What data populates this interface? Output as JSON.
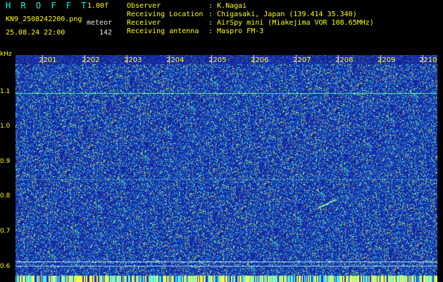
{
  "header": {
    "title": "H R O F F T",
    "version": "1.00f",
    "filename": "KN9_2508242200.png",
    "datetime": "25.08.24 22:00",
    "category": "meteor",
    "count": "142",
    "info": [
      {
        "label": "Observer",
        "value": ": K.Nagai"
      },
      {
        "label": "Receiving Location",
        "value": ": Chigasaki, Japan (139.414 35.340)"
      },
      {
        "label": "Receiver",
        "value": ": AirSpy mini (Miakejima VOR 108.65MHz)"
      },
      {
        "label": "Receiving antenna",
        "value": ": Maspro FM-3"
      }
    ]
  },
  "axis": {
    "y_unit": "kHz",
    "y_ticks": [
      "1.1",
      "1.0",
      "0.9",
      "0.8",
      "0.7",
      "0.6"
    ],
    "x_ticks": [
      "2201",
      "2202",
      "2203",
      "2204",
      "2205",
      "2206",
      "2207",
      "2208",
      "2209",
      "2210"
    ]
  },
  "colors": {
    "background": "#000000",
    "spectrum_base": "#1a2fa8",
    "accent_cyan": "#00ffe0",
    "label_yellow": "#ffff00"
  }
}
